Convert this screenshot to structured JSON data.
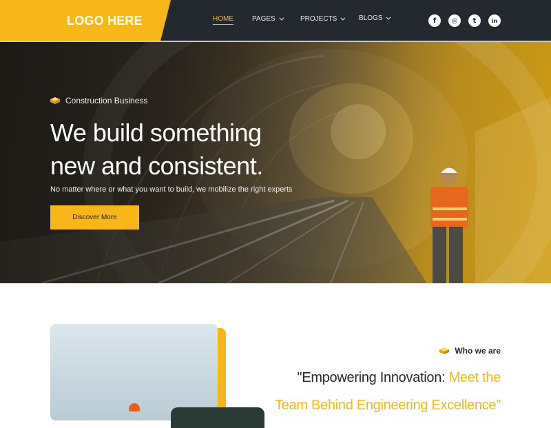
{
  "header": {
    "logo": "LOGO HERE",
    "nav": [
      {
        "label": "HOME",
        "active": true,
        "dropdown": false
      },
      {
        "label": "PAGES",
        "active": false,
        "dropdown": true
      },
      {
        "label": "PROJECTS",
        "active": false,
        "dropdown": true
      },
      {
        "label": "BLOGS",
        "active": false,
        "dropdown": true
      }
    ],
    "social": [
      {
        "icon": "facebook-icon",
        "glyph": "f"
      },
      {
        "icon": "instagram-icon",
        "glyph": "◎"
      },
      {
        "icon": "twitter-icon",
        "glyph": "t"
      },
      {
        "icon": "linkedin-icon",
        "glyph": "in"
      }
    ]
  },
  "hero": {
    "tag": "Construction Business",
    "title_line1": "We build something",
    "title_line2": "new and consistent.",
    "subtitle": "No matter where or what you want to build, we mobilize the right experts",
    "cta_label": "Discover More"
  },
  "about": {
    "tag": "Who we are",
    "quote_dark": "\"Empowering Innovation: ",
    "quote_highlight_1": "Meet the",
    "quote_highlight_2": "Team Behind  Engineering Excellence\""
  },
  "colors": {
    "accent": "#f7b718",
    "dark": "#24282f"
  }
}
